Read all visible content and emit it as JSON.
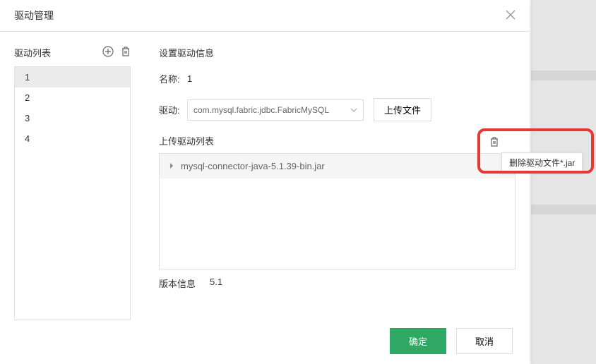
{
  "dialog": {
    "title": "驱动管理"
  },
  "left": {
    "list_title": "驱动列表",
    "items": [
      "1",
      "2",
      "3",
      "4"
    ],
    "active_index": 0
  },
  "right": {
    "section_title": "设置驱动信息",
    "name_label": "名称:",
    "name_value": "1",
    "driver_label": "驱动:",
    "driver_value": "com.mysql.fabric.jdbc.FabricMySQL",
    "upload_btn": "上传文件",
    "upload_list_title": "上传驱动列表",
    "files": [
      "mysql-connector-java-5.1.39-bin.jar"
    ],
    "version_label": "版本信息",
    "version_value": "5.1"
  },
  "footer": {
    "confirm": "确定",
    "cancel": "取消"
  },
  "tooltip": "删除驱动文件*.jar"
}
